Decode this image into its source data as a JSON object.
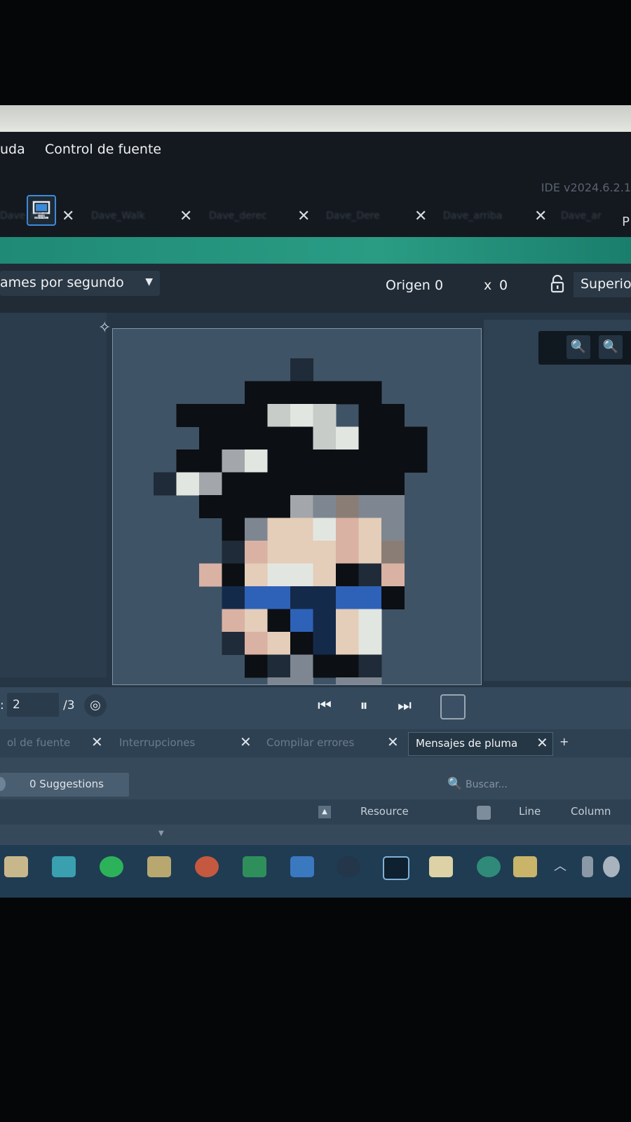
{
  "menu": {
    "items": [
      "uda",
      "Control de fuente"
    ],
    "version": "IDE v2024.6.2.1",
    "right_truncated": "P"
  },
  "document_tabs": [
    "Dave_Idle",
    "Dave_Walk",
    "Dave_derec",
    "Dave_Dere",
    "Dave_arriba",
    "Dave_ar"
  ],
  "toolbar": {
    "fps_label": "ames por segundo",
    "origin_label": "Origen",
    "origin_x": "0",
    "origin_times": "x",
    "origin_y": "0",
    "layer_label": "Superior"
  },
  "zoom": {
    "zoom_out_icon": "zoom-out-icon",
    "zoom_in_icon": "zoom-in-icon"
  },
  "playback": {
    "frame_prefix": ":",
    "frame_value": "2",
    "frame_total": "/3"
  },
  "output_tabs": {
    "tab1": "ol de fuente",
    "tab2": "Interrupciones",
    "tab3": "Compilar errores",
    "tab4": "Mensajes de pluma",
    "add": "+"
  },
  "output": {
    "suggestions": "0 Suggestions",
    "search_placeholder": "Buscar...",
    "columns": [
      "Resource",
      "Line",
      "Column"
    ]
  },
  "colors": {
    "accent_green": "#2a9c84",
    "accent_blue": "#3e8ad8",
    "sprite_dark": "#0d1014",
    "sprite_skin": "#e0c8b6",
    "sprite_blue": "#2e62b8"
  },
  "sprite_colors": {
    "k": "#0c0f13",
    "d": "#1f2b38",
    "w": "#c8ccc8",
    "l": "#e2e6e0",
    "s": "#e4cdb9",
    "p": "#d9b2a4",
    "g": "#7e8791",
    "h": "#a3a6aa",
    "m": "#8a7d75",
    "b": "#2e62b8",
    "n": "#142a4a"
  }
}
